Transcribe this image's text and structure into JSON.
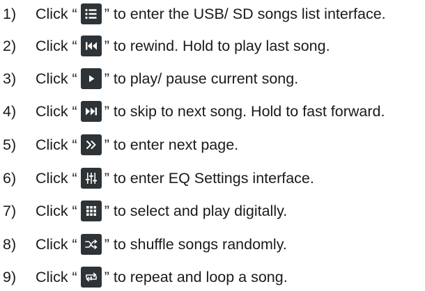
{
  "instructions": [
    {
      "num": "1)",
      "lead": "Click “",
      "icon": "list-icon",
      "tail": "” to enter the USB/ SD songs list interface."
    },
    {
      "num": "2)",
      "lead": "Click “",
      "icon": "rewind-icon",
      "tail": "” to rewind. Hold to play last song."
    },
    {
      "num": "3)",
      "lead": "Click “",
      "icon": "play-icon",
      "tail": "” to play/ pause current song."
    },
    {
      "num": "4)",
      "lead": "Click “",
      "icon": "skip-next-icon",
      "tail": "” to skip to next song. Hold to fast forward."
    },
    {
      "num": "5)",
      "lead": "Click “",
      "icon": "next-page-icon",
      "tail": "” to enter next page."
    },
    {
      "num": "6)",
      "lead": "Click “",
      "icon": "equalizer-icon",
      "tail": "” to enter EQ Settings interface."
    },
    {
      "num": "7)",
      "lead": "Click “",
      "icon": "numpad-icon",
      "tail": "” to select and play digitally."
    },
    {
      "num": "8)",
      "lead": "Click “",
      "icon": "shuffle-icon",
      "tail": "” to shuffle songs randomly."
    },
    {
      "num": "9)",
      "lead": "Click “",
      "icon": "repeat-icon",
      "tail": "” to repeat and loop a song."
    }
  ],
  "colors": {
    "icon_bg": "#2d3336",
    "icon_fg": "#ffffff",
    "text": "#1a1a1a"
  }
}
